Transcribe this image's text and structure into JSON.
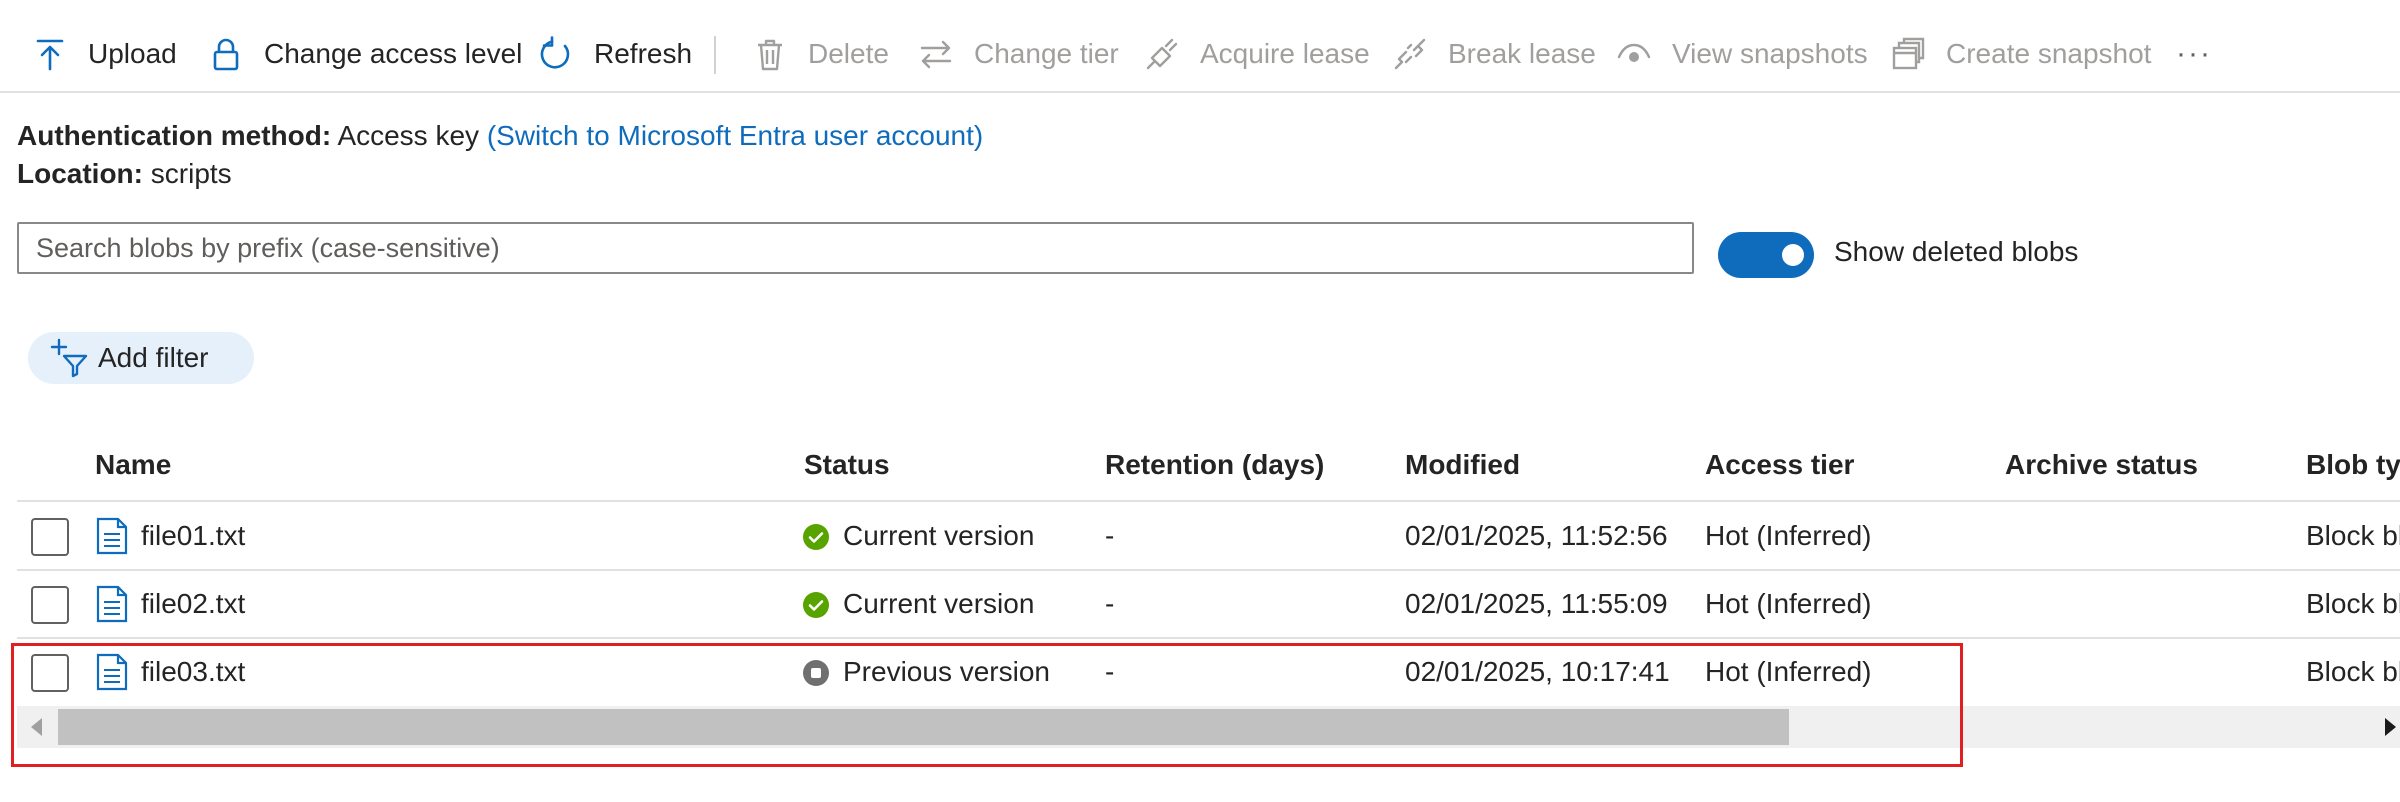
{
  "toolbar": {
    "upload": "Upload",
    "change_access_level": "Change access level",
    "refresh": "Refresh",
    "delete": "Delete",
    "change_tier": "Change tier",
    "acquire_lease": "Acquire lease",
    "break_lease": "Break lease",
    "view_snapshots": "View snapshots",
    "create_snapshot": "Create snapshot",
    "more": "···"
  },
  "info": {
    "auth_label": "Authentication method:",
    "auth_value": "Access key",
    "auth_switch_link": "(Switch to Microsoft Entra user account)",
    "location_label": "Location:",
    "location_value": "scripts"
  },
  "search": {
    "placeholder": "Search blobs by prefix (case-sensitive)"
  },
  "toggle": {
    "label": "Show deleted blobs",
    "on": true
  },
  "filter": {
    "label": "Add filter"
  },
  "table": {
    "columns": [
      "Name",
      "Status",
      "Retention (days)",
      "Modified",
      "Access tier",
      "Archive status",
      "Blob typ"
    ],
    "rows": [
      {
        "name": "file01.txt",
        "status": "Current version",
        "retention": "-",
        "modified": "02/01/2025, 11:52:56",
        "access_tier": "Hot (Inferred)",
        "archive_status": "",
        "blob_type": "Block bl"
      },
      {
        "name": "file02.txt",
        "status": "Current version",
        "retention": "-",
        "modified": "02/01/2025, 11:55:09",
        "access_tier": "Hot (Inferred)",
        "archive_status": "",
        "blob_type": "Block bl"
      },
      {
        "name": "file03.txt",
        "status": "Previous version",
        "retention": "-",
        "modified": "02/01/2025, 10:17:41",
        "access_tier": "Hot (Inferred)",
        "archive_status": "",
        "blob_type": "Block bl"
      }
    ]
  },
  "colors": {
    "accent": "#0f6cbd",
    "success": "#57a300",
    "previous": "#707070",
    "highlight": "#e02020"
  }
}
